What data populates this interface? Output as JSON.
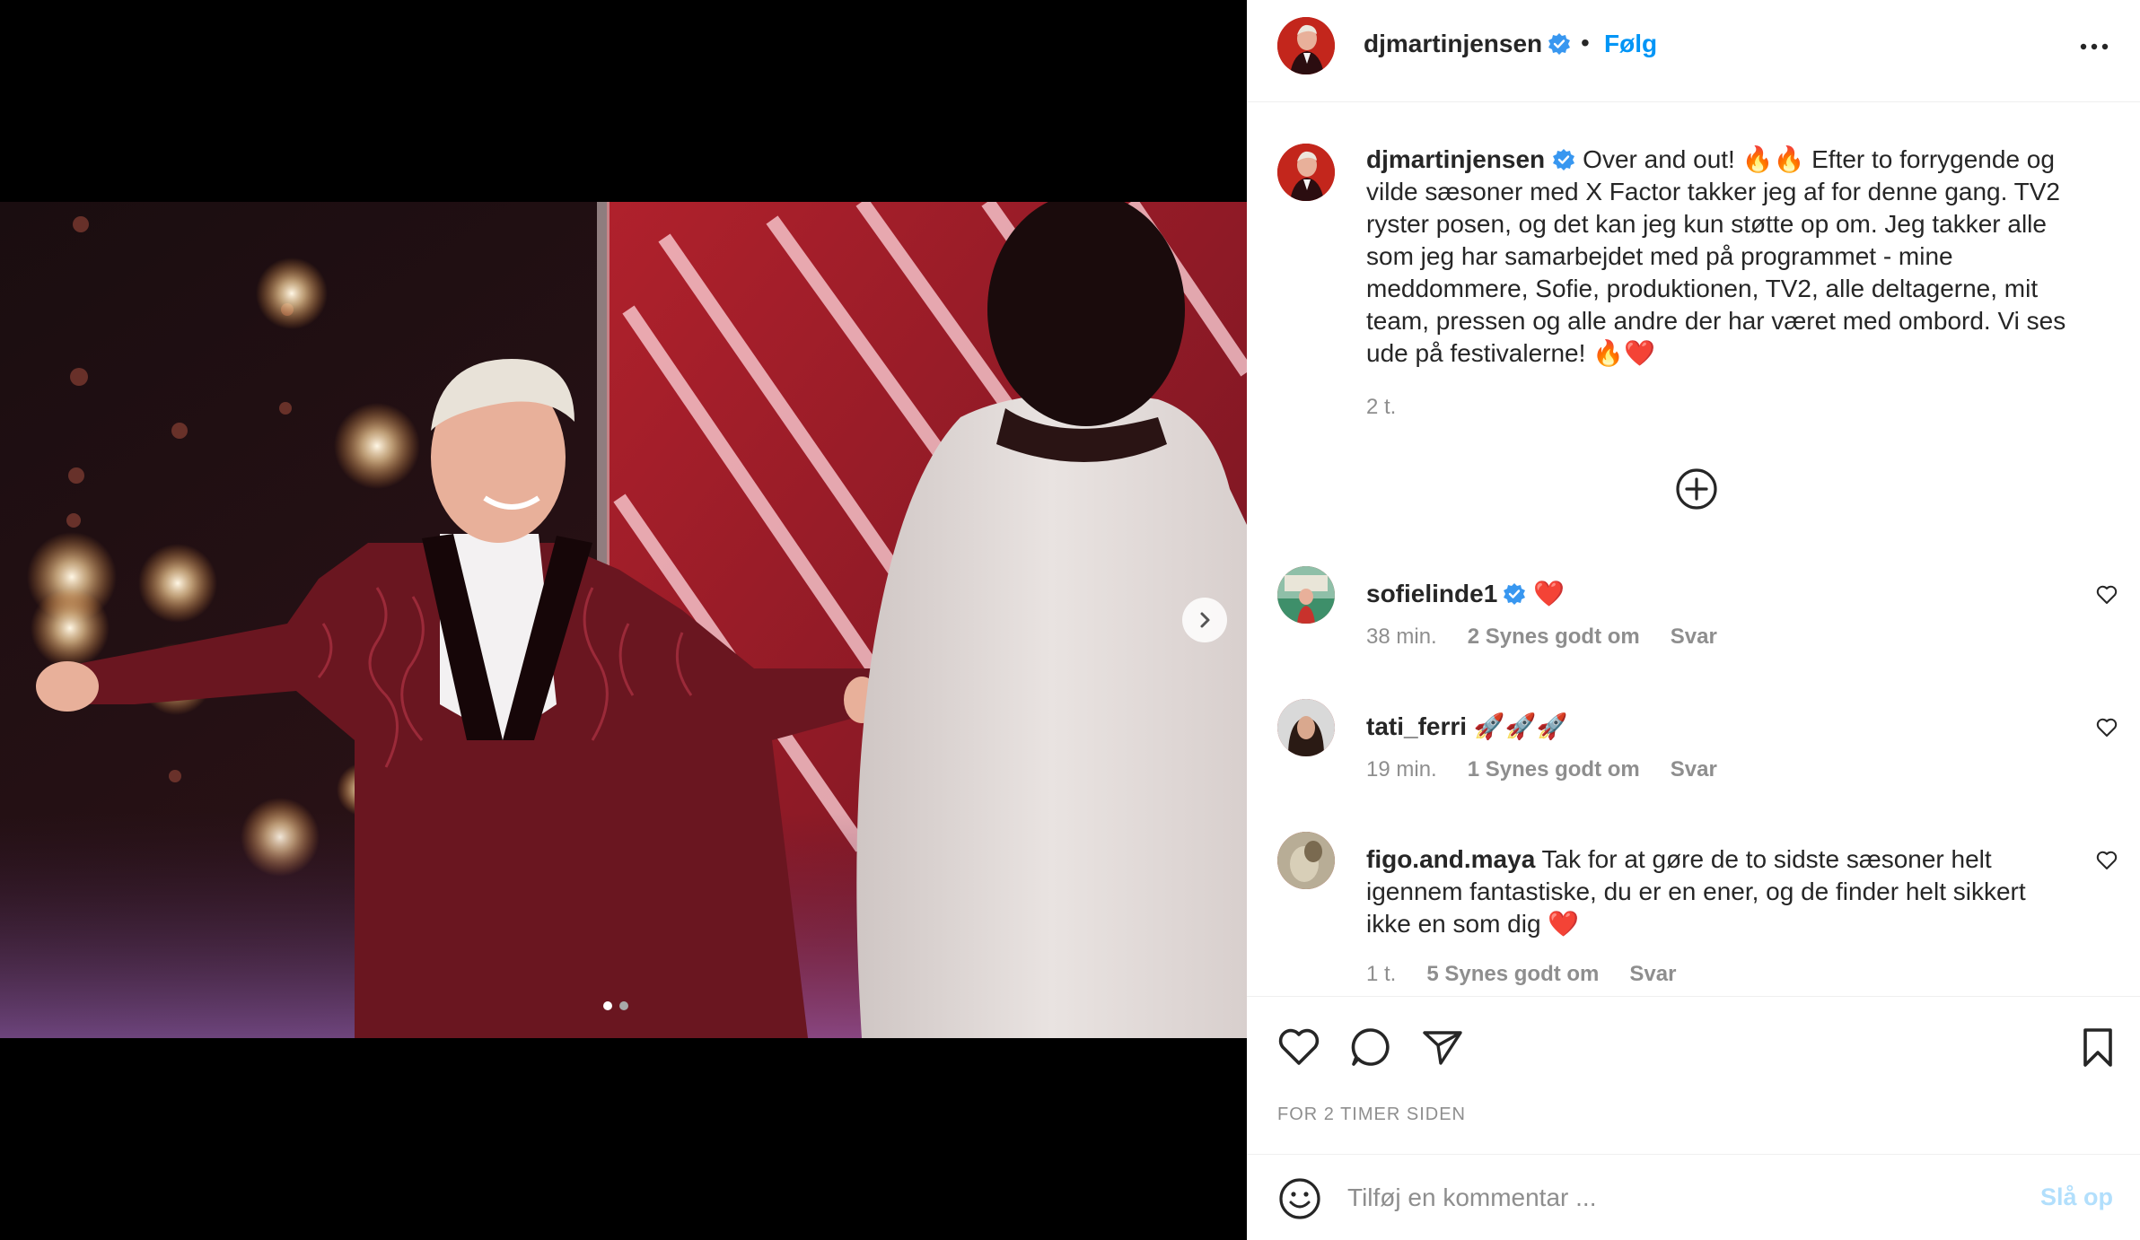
{
  "post": {
    "author": "djmartinjensen",
    "follow_label": "Følg",
    "separator": "•",
    "caption": "Over and out! 🔥🔥 Efter to forrygende og vilde sæsoner med X Factor takker jeg af for denne gang. TV2 ryster posen, og det kan jeg kun støtte op om. Jeg takker alle som jeg har samarbejdet med på programmet - mine meddommere, Sofie, produktionen, TV2, alle deltagerne, mit team, pressen og alle andre der har været med ombord. Vi ses ude på festivalerne! 🔥❤️",
    "caption_age": "2 t.",
    "timestamp": "FOR 2 TIMER SIDEN"
  },
  "carousel": {
    "total": 2,
    "current": 1
  },
  "comments": [
    {
      "user": "sofielinde1",
      "verified": true,
      "text": "❤️",
      "age": "38 min.",
      "likes": "2 Synes godt om",
      "reply": "Svar"
    },
    {
      "user": "tati_ferri",
      "verified": false,
      "text": "🚀🚀🚀",
      "age": "19 min.",
      "likes": "1 Synes godt om",
      "reply": "Svar"
    },
    {
      "user": "figo.and.maya",
      "verified": false,
      "text": "Tak for at gøre de to sidste sæsoner helt igennem fantastiske, du er en ener, og de finder helt sikkert ikke en som dig ❤️",
      "age": "1 t.",
      "likes": "5 Synes godt om",
      "reply": "Svar"
    }
  ],
  "comment_box": {
    "placeholder": "Tilføj en kommentar ...",
    "post_label": "Slå op"
  },
  "colors": {
    "link": "#0095f6",
    "post_disabled": "#b2dffc",
    "muted": "#8e8e8e",
    "verified": "#3897f0"
  }
}
